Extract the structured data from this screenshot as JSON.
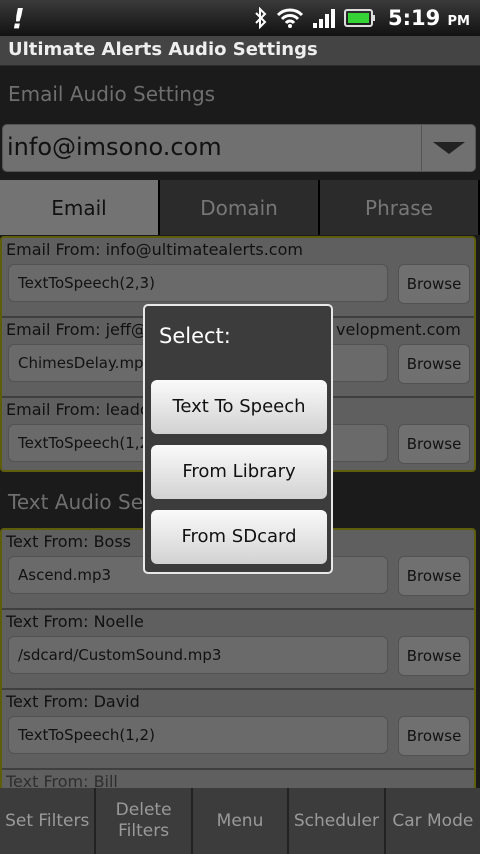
{
  "status_bar": {
    "time": "5:19",
    "ampm": "PM"
  },
  "app_title": "Ultimate Alerts Audio Settings",
  "email_section": {
    "header": "Email Audio Settings",
    "account": "info@imsono.com",
    "tabs": [
      {
        "label": "Email",
        "active": true
      },
      {
        "label": "Domain",
        "active": false
      },
      {
        "label": "Phrase",
        "active": false
      }
    ],
    "rows": [
      {
        "label": "Email From: info@ultimatealerts.com",
        "value": "TextToSpeech(2,3)",
        "browse": "Browse"
      },
      {
        "label": "Email From: jeff@",
        "label_tail": "velopment.com",
        "value": "ChimesDelay.mp3",
        "browse": "Browse"
      },
      {
        "label": "Email From: leado",
        "value": "TextToSpeech(1,2",
        "browse": "Browse"
      }
    ]
  },
  "text_section": {
    "header": "Text Audio Setti",
    "rows": [
      {
        "label": "Text From: Boss",
        "value": "Ascend.mp3",
        "browse": "Browse"
      },
      {
        "label": "Text From: Noelle",
        "value": "/sdcard/CustomSound.mp3",
        "browse": "Browse"
      },
      {
        "label": "Text From: David",
        "value": "TextToSpeech(1,2)",
        "browse": "Browse"
      }
    ],
    "partial_label": "Text From: Bill"
  },
  "bottom_menu": [
    {
      "label": "Set Filters"
    },
    {
      "label": "Delete Filters"
    },
    {
      "label": "Menu"
    },
    {
      "label": "Scheduler"
    },
    {
      "label": "Car Mode"
    }
  ],
  "dialog": {
    "title": "Select:",
    "options": [
      "Text To Speech",
      "From Library",
      "From SDcard"
    ]
  }
}
